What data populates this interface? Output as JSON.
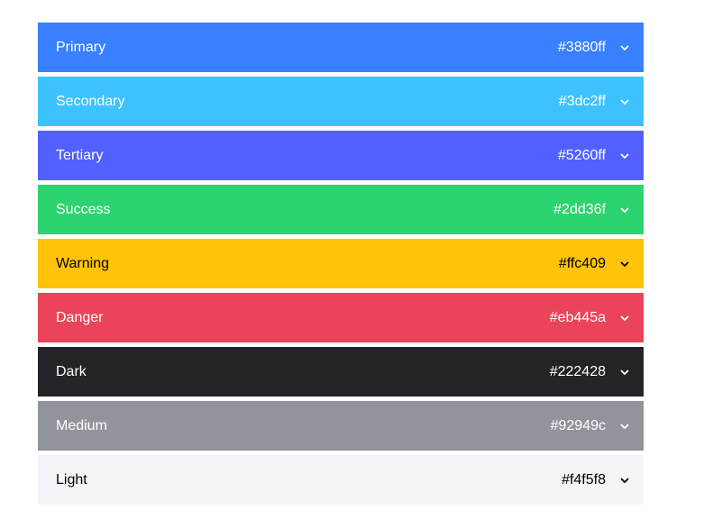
{
  "palette": {
    "colors": [
      {
        "name": "Primary",
        "hex": "#3880ff",
        "text_color": "#ffffff"
      },
      {
        "name": "Secondary",
        "hex": "#3dc2ff",
        "text_color": "#ffffff"
      },
      {
        "name": "Tertiary",
        "hex": "#5260ff",
        "text_color": "#ffffff"
      },
      {
        "name": "Success",
        "hex": "#2dd36f",
        "text_color": "#ffffff"
      },
      {
        "name": "Warning",
        "hex": "#ffc409",
        "text_color": "#000000"
      },
      {
        "name": "Danger",
        "hex": "#eb445a",
        "text_color": "#ffffff"
      },
      {
        "name": "Dark",
        "hex": "#222428",
        "text_color": "#ffffff"
      },
      {
        "name": "Medium",
        "hex": "#92949c",
        "text_color": "#ffffff"
      },
      {
        "name": "Light",
        "hex": "#f4f5f8",
        "text_color": "#000000"
      }
    ],
    "expand_icon": "chevron-down-icon"
  }
}
